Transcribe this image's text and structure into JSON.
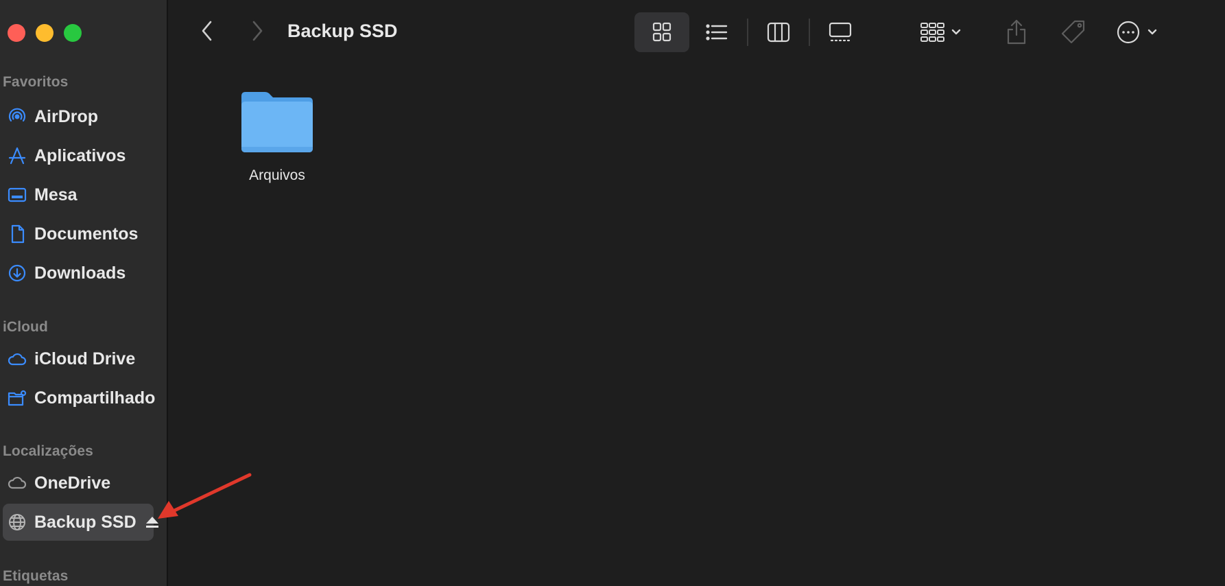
{
  "window": {
    "title": "Backup SSD"
  },
  "sidebar": {
    "sections": [
      {
        "title": "Favoritos",
        "items": [
          {
            "label": "AirDrop",
            "icon": "airdrop-icon"
          },
          {
            "label": "Aplicativos",
            "icon": "applications-icon"
          },
          {
            "label": "Mesa",
            "icon": "desktop-icon"
          },
          {
            "label": "Documentos",
            "icon": "document-icon"
          },
          {
            "label": "Downloads",
            "icon": "downloads-icon"
          }
        ]
      },
      {
        "title": "iCloud",
        "items": [
          {
            "label": "iCloud Drive",
            "icon": "icloud-icon"
          },
          {
            "label": "Compartilhado",
            "icon": "shared-folder-icon"
          }
        ]
      },
      {
        "title": "Localizações",
        "items": [
          {
            "label": "OneDrive",
            "icon": "cloud-icon"
          },
          {
            "label": "Backup SSD",
            "icon": "globe-icon",
            "selected": true,
            "eject": true
          }
        ]
      },
      {
        "title": "Etiquetas",
        "items": []
      }
    ]
  },
  "toolbar": {
    "back": "chevron-left-icon",
    "forward": "chevron-right-icon",
    "views": [
      "icon-view",
      "list-view",
      "column-view",
      "gallery-view"
    ],
    "active_view": "icon-view",
    "actions": [
      "group-icon",
      "share-icon",
      "tag-icon",
      "more-icon"
    ]
  },
  "content": {
    "items": [
      {
        "name": "Arquivos",
        "kind": "folder"
      }
    ]
  },
  "colors": {
    "accent": "#3b8cff",
    "folder": "#6cb6f5",
    "annotation": "#e0382b"
  }
}
